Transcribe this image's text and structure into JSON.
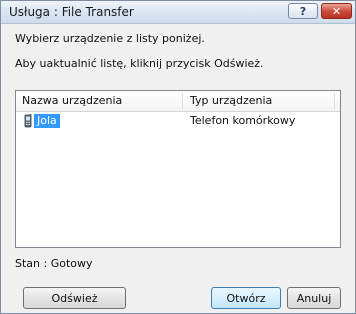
{
  "window": {
    "title": "Usługa : File Transfer",
    "help_label": "?",
    "close_label": "✕"
  },
  "instructions": {
    "line1": "Wybierz urządzenie z listy poniżej.",
    "line2": "Aby uaktualnić listę, kliknij przycisk Odśwież."
  },
  "device_list": {
    "columns": [
      "Nazwa urządzenia",
      "Typ urządzenia"
    ],
    "rows": [
      {
        "name": "Jola",
        "type": "Telefon komórkowy",
        "icon": "mobile-phone-icon",
        "selected": true
      }
    ]
  },
  "status": {
    "text": "Stan : Gotowy"
  },
  "buttons": {
    "refresh": "Odśwież",
    "open": "Otwórz",
    "cancel": "Anuluj"
  },
  "colors": {
    "selection": "#3399ff",
    "close_button": "#c9483a"
  }
}
